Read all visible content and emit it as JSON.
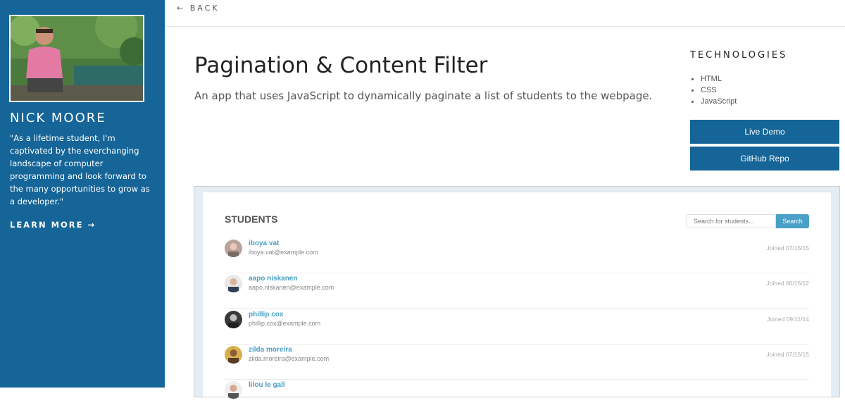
{
  "nav": {
    "back_label": "← BACK"
  },
  "profile": {
    "name": "NICK MOORE",
    "quote": "\"As a lifetime student, I'm captivated by the everchanging landscape of computer programming and look forward to the many opportunities to grow as a developer.\"",
    "learn_more": "LEARN MORE →"
  },
  "project": {
    "title": "Pagination & Content Filter",
    "description": "An app that uses JavaScript to dynamically paginate a list of students to the webpage."
  },
  "technologies": {
    "heading": "TECHNOLOGIES",
    "items": [
      "HTML",
      "CSS",
      "JavaScript"
    ]
  },
  "actions": {
    "live_demo": "Live Demo",
    "github_repo": "GitHub Repo"
  },
  "preview": {
    "heading": "STUDENTS",
    "search_placeholder": "Search for students...",
    "search_button": "Search",
    "students": [
      {
        "name": "iboya vat",
        "email": "iboya.vat@example.com",
        "joined": "Joined 07/15/15"
      },
      {
        "name": "aapo niskanen",
        "email": "aapo.niskanen@example.com",
        "joined": "Joined 06/15/12"
      },
      {
        "name": "phillip cox",
        "email": "phillip.cox@example.com",
        "joined": "Joined 09/11/14"
      },
      {
        "name": "zilda moreira",
        "email": "zilda.moreira@example.com",
        "joined": "Joined 07/15/15"
      },
      {
        "name": "lilou le gall",
        "email": "",
        "joined": ""
      }
    ]
  },
  "colors": {
    "brand": "#156598",
    "accent": "#4aa0c6"
  }
}
